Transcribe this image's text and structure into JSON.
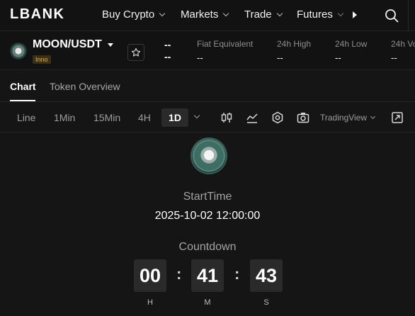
{
  "nav": {
    "logo": "LBANK",
    "items": [
      {
        "label": "Buy Crypto"
      },
      {
        "label": "Markets"
      },
      {
        "label": "Trade"
      },
      {
        "label": "Futures"
      }
    ],
    "icons": [
      "chevron-down-icon",
      "arrow-right-icon",
      "search-icon"
    ]
  },
  "pair": {
    "symbol": "MOON/USDT",
    "badge": "Inno",
    "price_top": "--",
    "price_bottom": "--",
    "stats": [
      {
        "label": "Fiat Equivalent",
        "value": "--"
      },
      {
        "label": "24h High",
        "value": "--"
      },
      {
        "label": "24h Low",
        "value": "--"
      },
      {
        "label": "24h Vo",
        "value": "--"
      }
    ]
  },
  "tabs": [
    {
      "label": "Chart",
      "active": true
    },
    {
      "label": "Token Overview",
      "active": false
    }
  ],
  "toolbar": {
    "timeframes": [
      "Line",
      "1Min",
      "15Min",
      "4H"
    ],
    "active_timeframe": "1D",
    "view_mode": "TradingView",
    "icons": [
      "candlestick-icon",
      "indicator-icon",
      "settings-icon",
      "camera-icon",
      "fullscreen-icon"
    ]
  },
  "launch": {
    "start_label": "StartTime",
    "start_value": "2025-10-02 12:00:00",
    "countdown_label": "Countdown",
    "hours": "00",
    "minutes": "41",
    "seconds": "43",
    "separator": ":",
    "units": {
      "h": "H",
      "m": "M",
      "s": "S"
    }
  },
  "colors": {
    "background": "#151515",
    "badge_text": "#e2b33a",
    "badge_bg": "#3a3016",
    "box_bg": "#2a2a2a"
  }
}
